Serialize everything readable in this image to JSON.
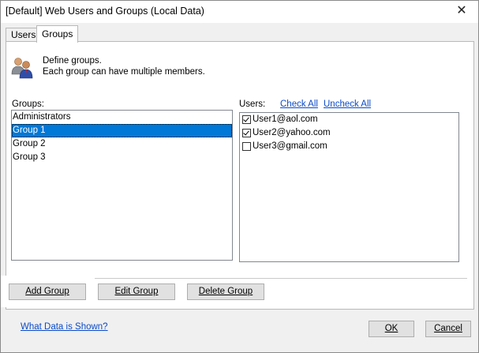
{
  "window": {
    "title": "[Default] Web Users and Groups (Local Data)",
    "close_glyph": "✕"
  },
  "tabs": [
    {
      "label": "Users",
      "active": false
    },
    {
      "label": "Groups",
      "active": true
    }
  ],
  "intro": {
    "icon": "users-group-icon",
    "line1": "Define groups.",
    "line2": "Each group can have multiple members."
  },
  "groups": {
    "label": "Groups:",
    "items": [
      "Administrators",
      "Group 1",
      "Group 2",
      "Group 3"
    ],
    "selected_index": 1
  },
  "users": {
    "label": "Users:",
    "check_all": "Check All",
    "uncheck_all": "Uncheck All",
    "items": [
      {
        "email": "User1@aol.com",
        "checked": true
      },
      {
        "email": "User2@yahoo.com",
        "checked": true
      },
      {
        "email": "User3@gmail.com",
        "checked": false
      }
    ]
  },
  "buttons": {
    "add": "Add Group",
    "edit": "Edit Group",
    "delete": "Delete Group",
    "ok": "OK",
    "cancel": "Cancel"
  },
  "footer_link": "What Data is Shown?",
  "colors": {
    "selection": "#0078d7",
    "link": "#0b4bc9"
  }
}
